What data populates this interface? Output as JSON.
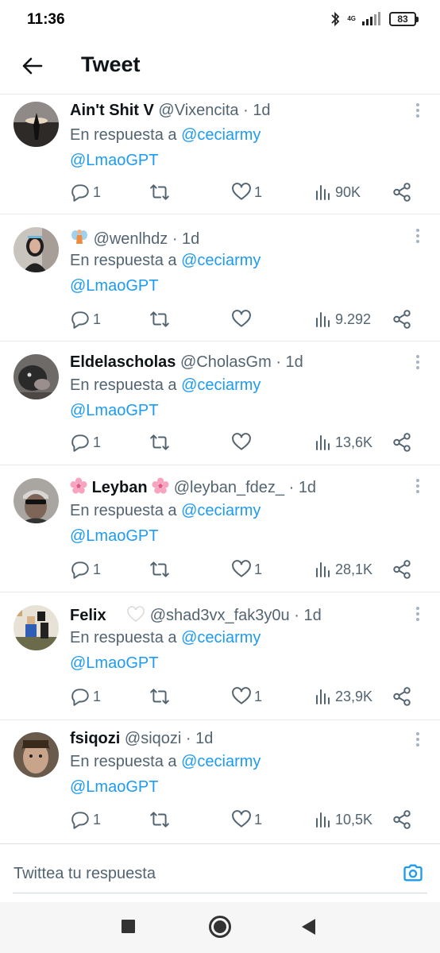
{
  "status": {
    "time": "11:36",
    "network": "4G",
    "battery": "83"
  },
  "header": {
    "title": "Tweet"
  },
  "tweets": [
    {
      "name": "Ain't Shit V",
      "handle": "@Vixencita",
      "sep": "·",
      "time": "1d",
      "reply_prefix": "En respuesta a",
      "reply_to": "@ceciarmy",
      "reply_to_2": "@LmaoGPT",
      "replies": "1",
      "retweets": "",
      "likes": "1",
      "views": "90K"
    },
    {
      "name": "",
      "name_emoji": "fairy",
      "handle": "@wenlhdz",
      "sep": "·",
      "time": "1d",
      "reply_prefix": "En respuesta a",
      "reply_to": "@ceciarmy",
      "reply_to_2": "@LmaoGPT",
      "replies": "1",
      "retweets": "",
      "likes": "",
      "views": "9.292"
    },
    {
      "name": "Eldelascholas",
      "handle": "@CholasGm",
      "sep": "·",
      "time": "1d",
      "reply_prefix": "En respuesta a",
      "reply_to": "@ceciarmy",
      "reply_to_2": "@LmaoGPT",
      "replies": "1",
      "retweets": "",
      "likes": "",
      "views": "13,6K"
    },
    {
      "name": "Leyban",
      "name_emoji": "cherry-blossom",
      "handle": "@leyban_fdez_",
      "sep": "·",
      "time": "1d",
      "reply_prefix": "En respuesta a",
      "reply_to": "@ceciarmy",
      "reply_to_2": "@LmaoGPT",
      "replies": "1",
      "retweets": "",
      "likes": "1",
      "views": "28,1K"
    },
    {
      "name": "Felix",
      "name_emoji": "white-heart",
      "handle": "@shad3vx_fak3y0u",
      "sep": "·",
      "time": "1d",
      "reply_prefix": "En respuesta a",
      "reply_to": "@ceciarmy",
      "reply_to_2": "@LmaoGPT",
      "replies": "1",
      "retweets": "",
      "likes": "1",
      "views": "23,9K"
    },
    {
      "name": "fsiqozi",
      "handle": "@siqozi",
      "sep": "·",
      "time": "1d",
      "reply_prefix": "En respuesta a",
      "reply_to": "@ceciarmy",
      "reply_to_2": "@LmaoGPT",
      "replies": "1",
      "retweets": "",
      "likes": "1",
      "views": "10,5K"
    }
  ],
  "composer": {
    "placeholder": "Twittea tu respuesta"
  },
  "colors": {
    "accent": "#1d9bf0",
    "text": "#0f1419",
    "muted": "#536471"
  },
  "icons": {
    "back": "arrow-left-icon",
    "reply": "comment-icon",
    "retweet": "retweet-icon",
    "like": "heart-icon",
    "views": "views-bar-chart-icon",
    "share": "share-icon",
    "more": "more-vertical-icon",
    "camera": "camera-icon"
  }
}
